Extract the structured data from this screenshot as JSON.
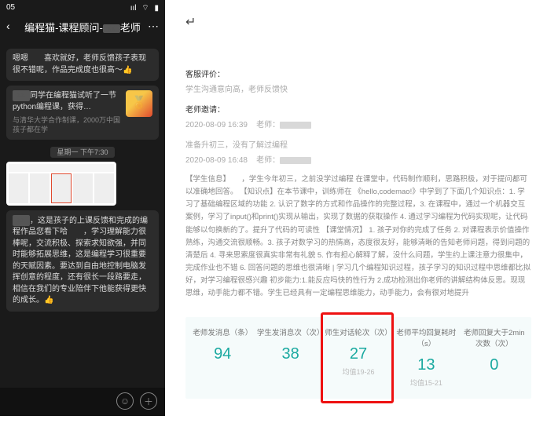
{
  "phone": {
    "status_time": "05",
    "signal_glyph": "ııl",
    "wifi_glyph": "⌔",
    "battery_glyph": "▮",
    "header": {
      "back_glyph": "‹",
      "title_prefix": "编程猫-课程顾问-",
      "title_suffix": "老师",
      "more_glyph": "⋯"
    },
    "msg1": "嗯嗯　　喜欢就好，老师反馈孩子表现很不错呢，作品完成度也很高～👍",
    "link_card": {
      "title": "同学在编程猫试听了一节 python编程课，获得…",
      "sub": "与清华大学合作制课，2000万中国孩子都在学"
    },
    "timestamp": "星期一 下午7:30",
    "msg2": "，这是孩子的上课反馈和完成的编程作品您看下哈　　，学习理解能力很棒呢，交流积极、探索求知欲强，并同时能够拓展思维，这是编程学习很重要的天赋因素。要达到自由地控制电脑发挥创意的程度，还有很长一段路要走，相信在我们的专业陪伴下他能获得更快的成长。👍",
    "emoji_glyph": "☺",
    "plus_glyph": "＋"
  },
  "report": {
    "return_glyph": "↵",
    "sec1_label": "客服评价：",
    "sec1_text": "学生沟通意向高，老师反馈快",
    "sec2_label": "老师邀请：",
    "sec2_time": "2020-08-09 16:39",
    "sec2_teacher_label": "老师：",
    "sec3_line1": "准备升初三，没有了解过编程",
    "sec3_time": "2020-08-09 16:48",
    "sec3_teacher_label": "老师：",
    "para": "【学生信息】　　，学生今年初三，之前没学过编程 在课堂中，代码制作顺利，思路积极，对于提问都可以准确地回答。 【知识点】在本节课中，训练师在 《hello,codemao!》中学到了下面几个知识点：1. 学习了基础编程区域的功能 2. 认识了数字的方式和作品操作的完整过程，3. 在课程中，通过一个机器交互案例，学习了input()和print()实现从输出，实现了数据的获取操作 4. 通过学习编程为代码实现呢，让代码能够以句换新的了。提升了代码的可读性 【课堂情况】 1. 孩子对你的完成了任务 2. 对课程表示价值操作熟练，沟通交流很顺畅。3. 孩子对数学习的热情高，态度很友好，能够清晰的告知老师问题，得到问题的清楚后 4. 寻来思索度很真实非常有礼貌 5. 作有担心解释了解，没什么问题，学生约上课注意力很集中，完成作业也不错 6. 回答问题的思维也很清晰 | 学习几个编程知识过程，孩子学习的知识过程中思维都比拟好，对学习编程很感兴趣 初步能力:1.能反应吗快的性行为 2.成功检测出你老师的讲解结构体反思。现现思维，动手能力都不错。学生已经具有一定编程思维能力，动手能力，会有很对地提升",
    "stats": [
      {
        "head": "老师发消息（条）",
        "val": "94",
        "sub": ""
      },
      {
        "head": "学生发消息次（次）",
        "val": "38",
        "sub": ""
      },
      {
        "head": "师生对话轮次（次）",
        "val": "27",
        "sub": "均值19-26"
      },
      {
        "head": "老师平均回复耗时（s）",
        "val": "13",
        "sub": "均值15-21"
      },
      {
        "head": "老师回复大于2min次数（次）",
        "val": "0",
        "sub": ""
      }
    ],
    "highlight_index": 2
  }
}
